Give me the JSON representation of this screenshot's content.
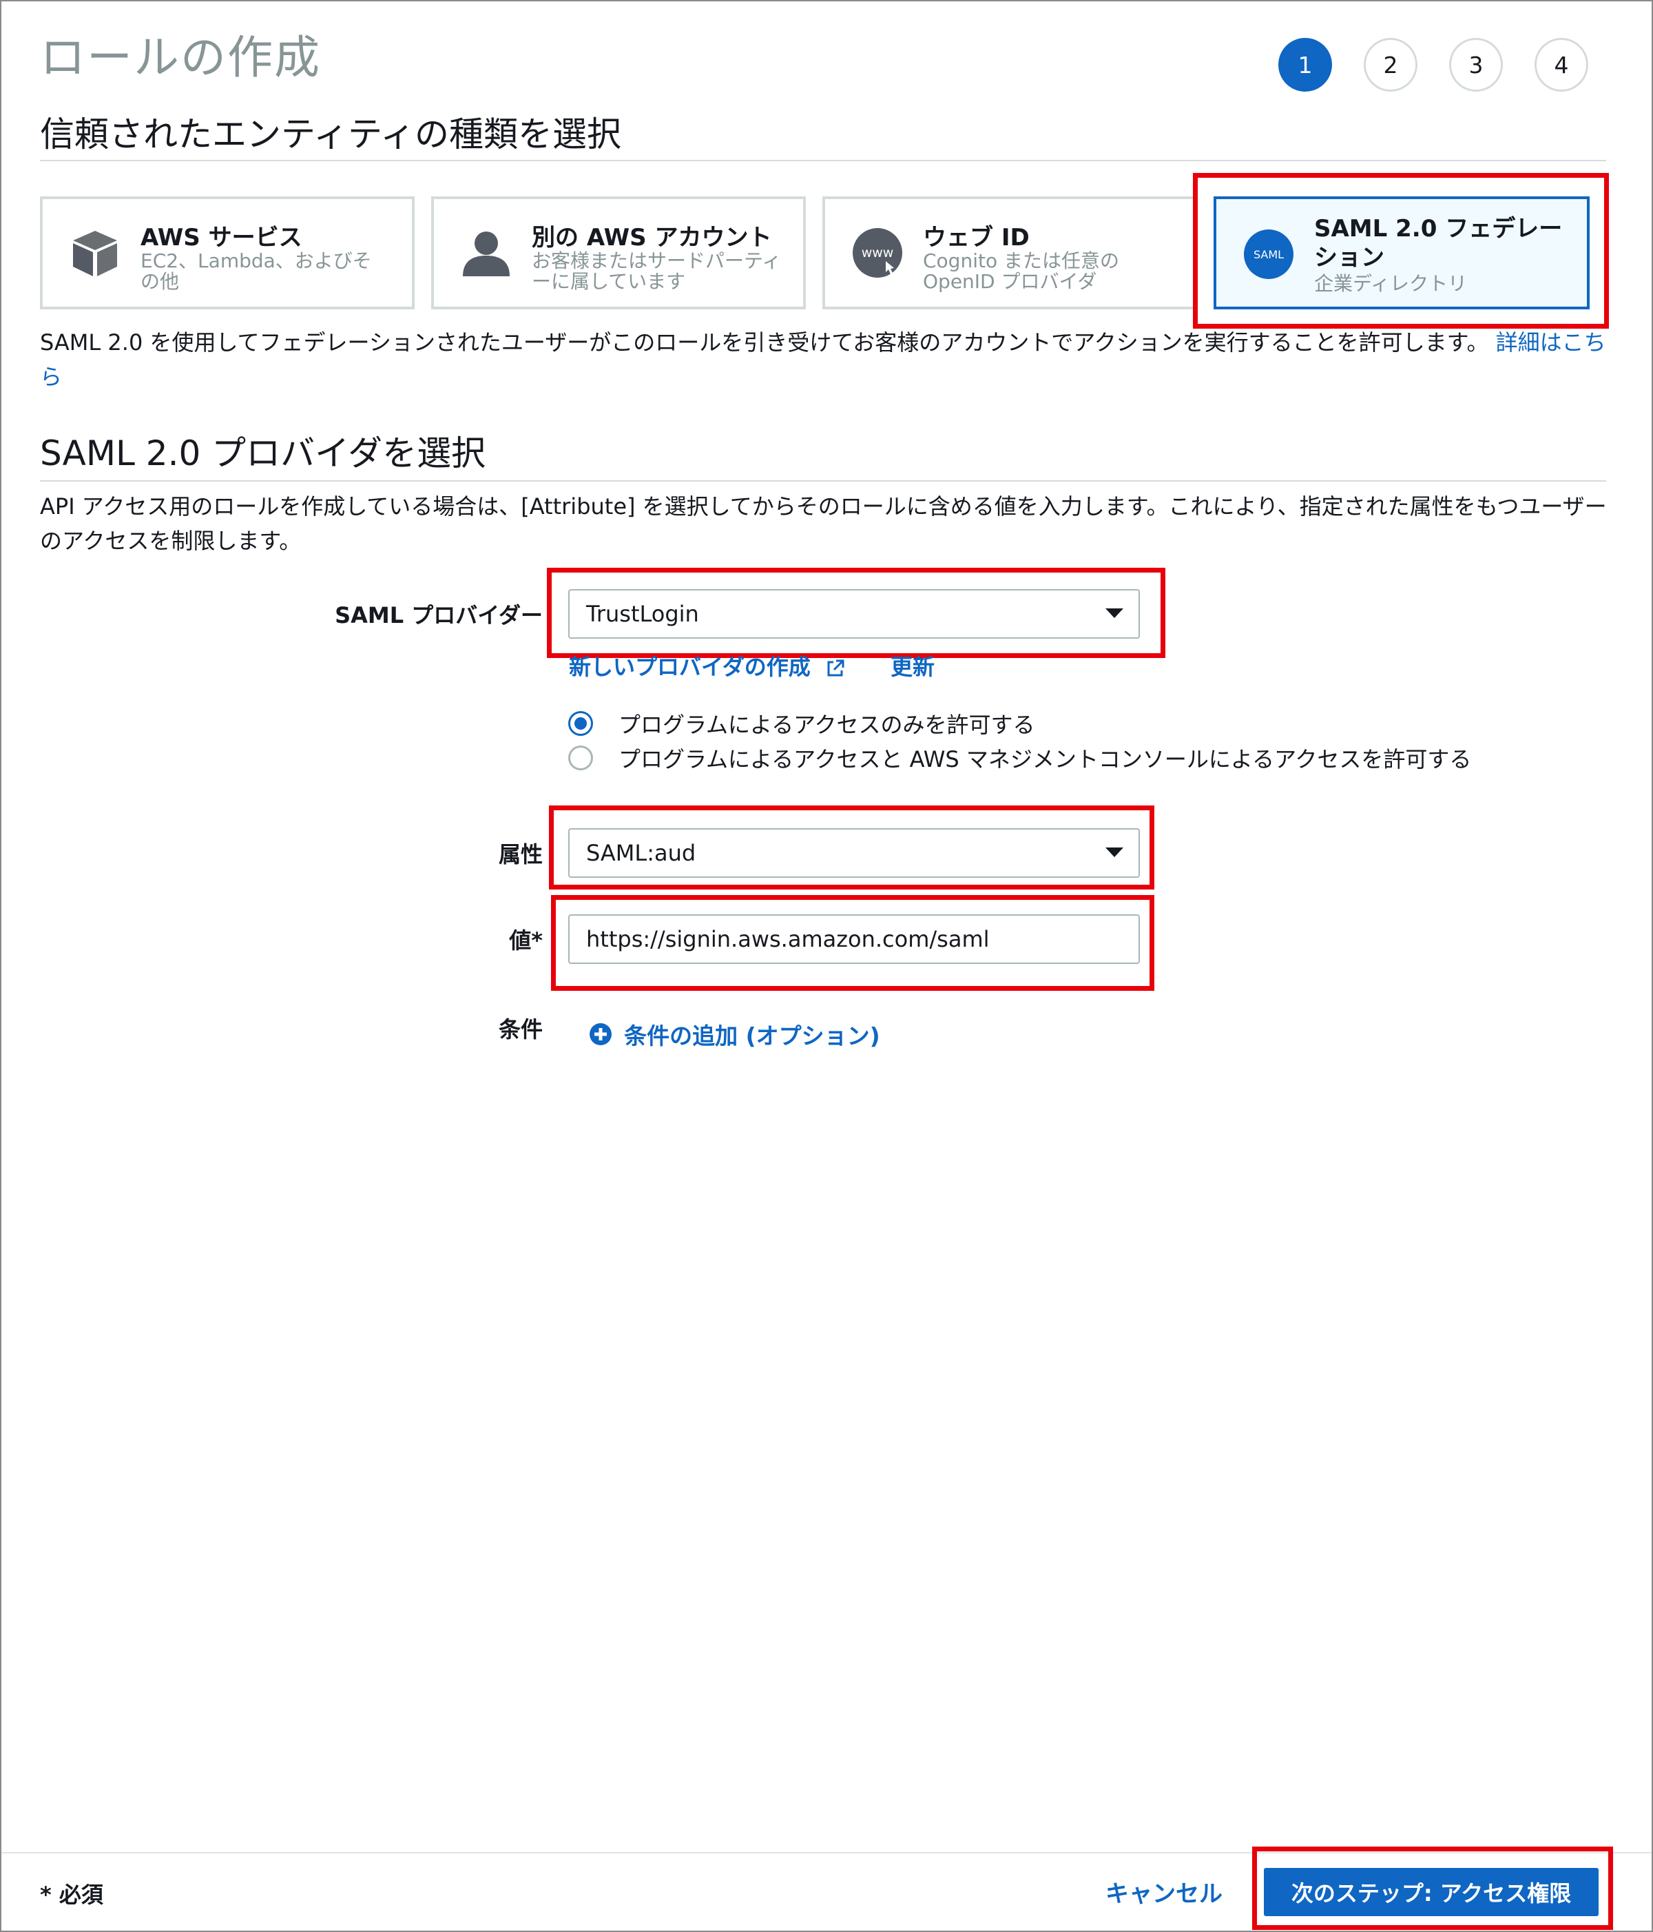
{
  "page": {
    "title": "ロールの作成",
    "steps": [
      "1",
      "2",
      "3",
      "4"
    ]
  },
  "trusted_entity": {
    "heading": "信頼されたエンティティの種類を選択",
    "cards": [
      {
        "title": "AWS サービス",
        "subtitle": "EC2、Lambda、およびその他",
        "icon": "cube-icon"
      },
      {
        "title": "別の AWS アカウント",
        "subtitle": "お客様またはサードパーティーに属しています",
        "icon": "user-icon"
      },
      {
        "title": "ウェブ ID",
        "subtitle": "Cognito または任意の OpenID プロバイダ",
        "icon": "www-globe-icon",
        "icon_text": "www"
      },
      {
        "title": "SAML 2.0 フェデレーション",
        "subtitle": "企業ディレクトリ",
        "icon": "saml-icon",
        "icon_text": "SAML",
        "selected": true
      }
    ],
    "description": "SAML 2.0 を使用してフェデレーションされたユーザーがこのロールを引き受けてお客様のアカウントでアクションを実行することを許可します。",
    "learn_more": "詳細はこちら"
  },
  "saml_provider": {
    "heading": "SAML 2.0 プロバイダを選択",
    "description": "API アクセス用のロールを作成している場合は、[Attribute] を選択してからそのロールに含める値を入力します。これにより、指定された属性をもつユーザーのアクセスを制限します。",
    "provider_label": "SAML プロバイダー",
    "provider_value": "TrustLogin",
    "create_provider_link": "新しいプロバイダの作成",
    "refresh_link": "更新",
    "access_options": [
      {
        "label": "プログラムによるアクセスのみを許可する",
        "checked": true
      },
      {
        "label": "プログラムによるアクセスと AWS マネジメントコンソールによるアクセスを許可する",
        "checked": false
      }
    ],
    "attribute_label": "属性",
    "attribute_value": "SAML:aud",
    "value_label": "値*",
    "value_value": "https://signin.aws.amazon.com/saml",
    "condition_label": "条件",
    "add_condition_link": "条件の追加 (オプション)"
  },
  "footer": {
    "required_note": "* 必須",
    "cancel": "キャンセル",
    "next": "次のステップ: アクセス権限"
  },
  "colors": {
    "accent": "#0f66c3",
    "highlight": "#e8000b",
    "muted": "#879596"
  }
}
